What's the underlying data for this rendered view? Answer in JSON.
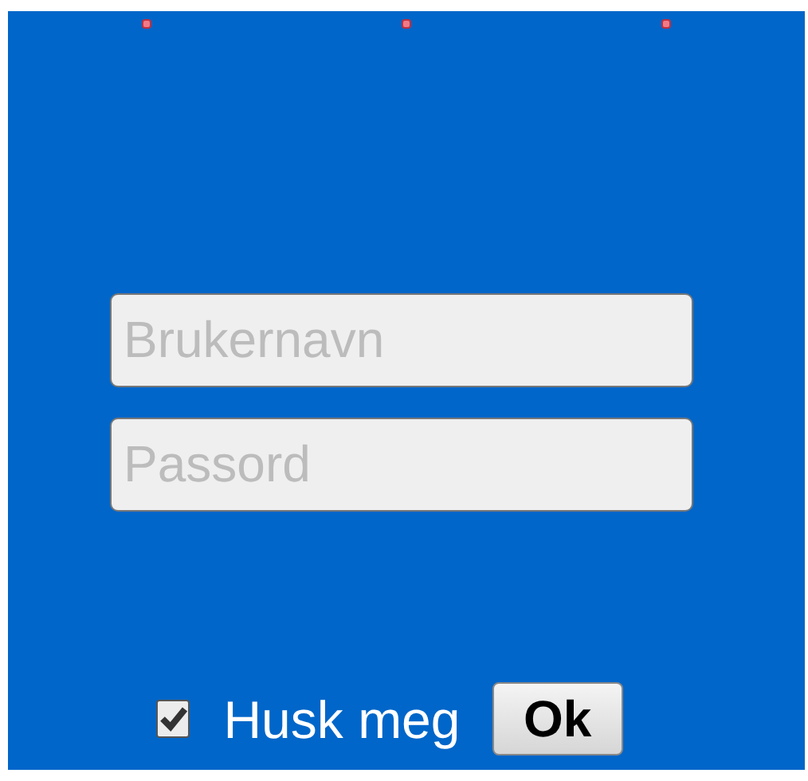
{
  "fields": [
    {
      "placeholder": "Brukernavn"
    },
    {
      "placeholder": "Passord"
    }
  ],
  "remember": {
    "label": "Husk meg",
    "checked": true
  },
  "buttons": [
    "Ok"
  ]
}
